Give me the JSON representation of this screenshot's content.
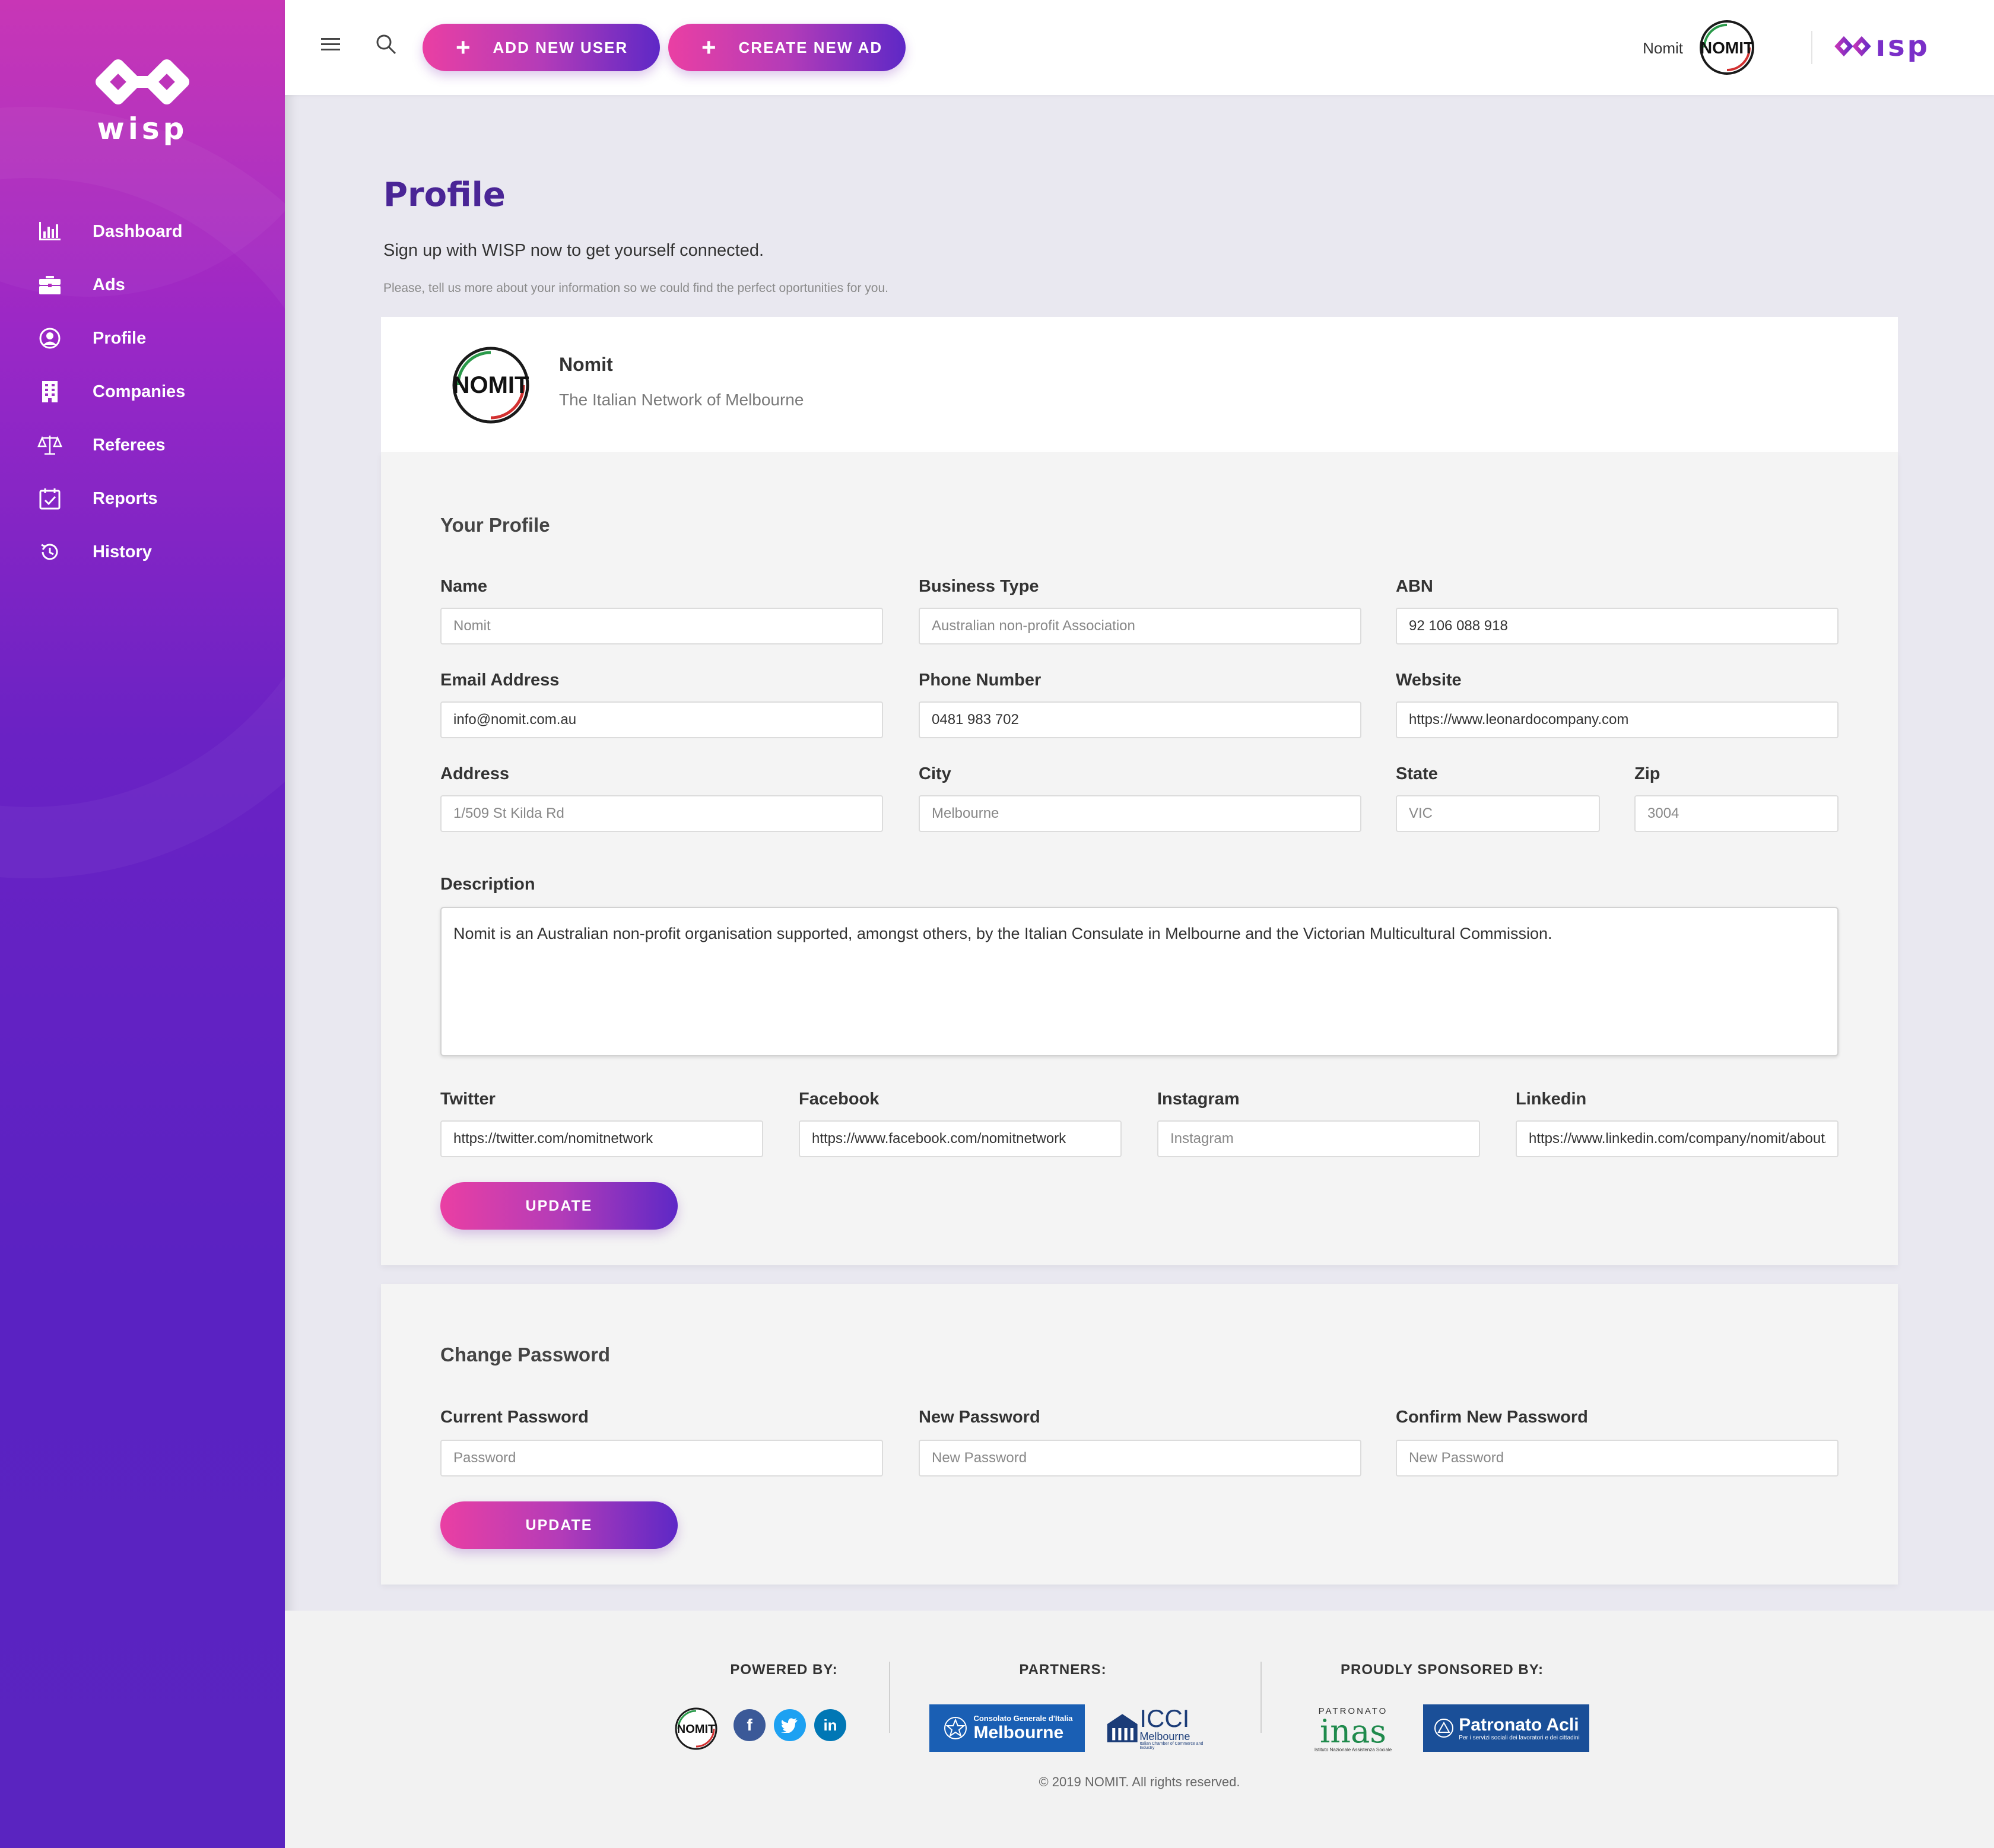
{
  "app": {
    "brand": "wisp",
    "brand_top": "ısp"
  },
  "sidebar": {
    "items": [
      {
        "label": "Dashboard",
        "icon": "bar-chart-icon"
      },
      {
        "label": "Ads",
        "icon": "briefcase-icon"
      },
      {
        "label": "Profile",
        "icon": "user-circle-icon"
      },
      {
        "label": "Companies",
        "icon": "building-icon"
      },
      {
        "label": "Referees",
        "icon": "scales-icon"
      },
      {
        "label": "Reports",
        "icon": "calendar-check-icon"
      },
      {
        "label": "History",
        "icon": "history-icon"
      }
    ]
  },
  "topbar": {
    "add_user_label": "ADD NEW USER",
    "create_ad_label": "CREATE NEW AD",
    "user_name": "Nomit"
  },
  "page": {
    "title": "Profile",
    "subtitle": "Sign up with WISP now to get yourself connected.",
    "helper": "Please, tell us more about your information so we could find the perfect oportunities for you."
  },
  "org": {
    "name": "Nomit",
    "tagline": "The Italian Network of Melbourne",
    "logo_text": "NOMIT"
  },
  "profile": {
    "section_title": "Your Profile",
    "name": {
      "label": "Name",
      "value": "",
      "placeholder": "Nomit"
    },
    "business_type": {
      "label": "Business Type",
      "value": "",
      "placeholder": "Australian non-profit Association"
    },
    "abn": {
      "label": "ABN",
      "value": "92 106 088 918"
    },
    "email": {
      "label": "Email Address",
      "value": "info@nomit.com.au"
    },
    "phone": {
      "label": "Phone Number",
      "value": "0481 983 702"
    },
    "website": {
      "label": "Website",
      "value": "https://www.leonardocompany.com"
    },
    "address": {
      "label": "Address",
      "value": "",
      "placeholder": "1/509 St Kilda Rd"
    },
    "city": {
      "label": "City",
      "value": "",
      "placeholder": "Melbourne"
    },
    "state": {
      "label": "State",
      "value": "",
      "placeholder": "VIC"
    },
    "zip": {
      "label": "Zip",
      "value": "",
      "placeholder": "3004"
    },
    "description": {
      "label": "Description",
      "value": "Nomit is an Australian non-profit organisation supported, amongst others, by the Italian Consulate in Melbourne and the Victorian Multicultural Commission."
    },
    "twitter": {
      "label": "Twitter",
      "value": "https://twitter.com/nomitnetwork"
    },
    "facebook": {
      "label": "Facebook",
      "value": "https://www.facebook.com/nomitnetwork"
    },
    "instagram": {
      "label": "Instagram",
      "value": "",
      "placeholder": "Instagram"
    },
    "linkedin": {
      "label": "Linkedin",
      "value": "https://www.linkedin.com/company/nomit/about/"
    },
    "update_label": "UPDATE"
  },
  "password": {
    "section_title": "Change Password",
    "current": {
      "label": "Current Password",
      "placeholder": "Password"
    },
    "new": {
      "label": "New Password",
      "placeholder": "New Password"
    },
    "confirm": {
      "label": "Confirm New Password",
      "placeholder": "New Password"
    },
    "update_label": "UPDATE"
  },
  "footer": {
    "powered_by": "POWERED BY:",
    "partners": "PARTNERS:",
    "sponsored_by": "PROUDLY SPONSORED BY:",
    "consolato_small": "Consolato Generale d'Italia",
    "consolato_big": "Melbourne",
    "icci_big": "ICCI",
    "icci_small": "Melbourne",
    "icci_tiny": "Italian Chamber of Commerce and Industry",
    "inas_top": "PATRONATO",
    "inas_big": "inas",
    "inas_small": "Istituto Nazionale Assistenza Sociale",
    "acli_big": "Patronato Acli",
    "acli_small": "Per i servizi sociali dei lavoratori e dei cittadini",
    "copyright": "© 2019 NOMIT. All rights reserved."
  },
  "colors": {
    "accent_pink": "#ea3fa3",
    "accent_purple": "#5e28c6",
    "title_purple": "#4a2596",
    "facebook": "#3b5998",
    "twitter": "#1da1f2",
    "linkedin": "#0077b5"
  }
}
